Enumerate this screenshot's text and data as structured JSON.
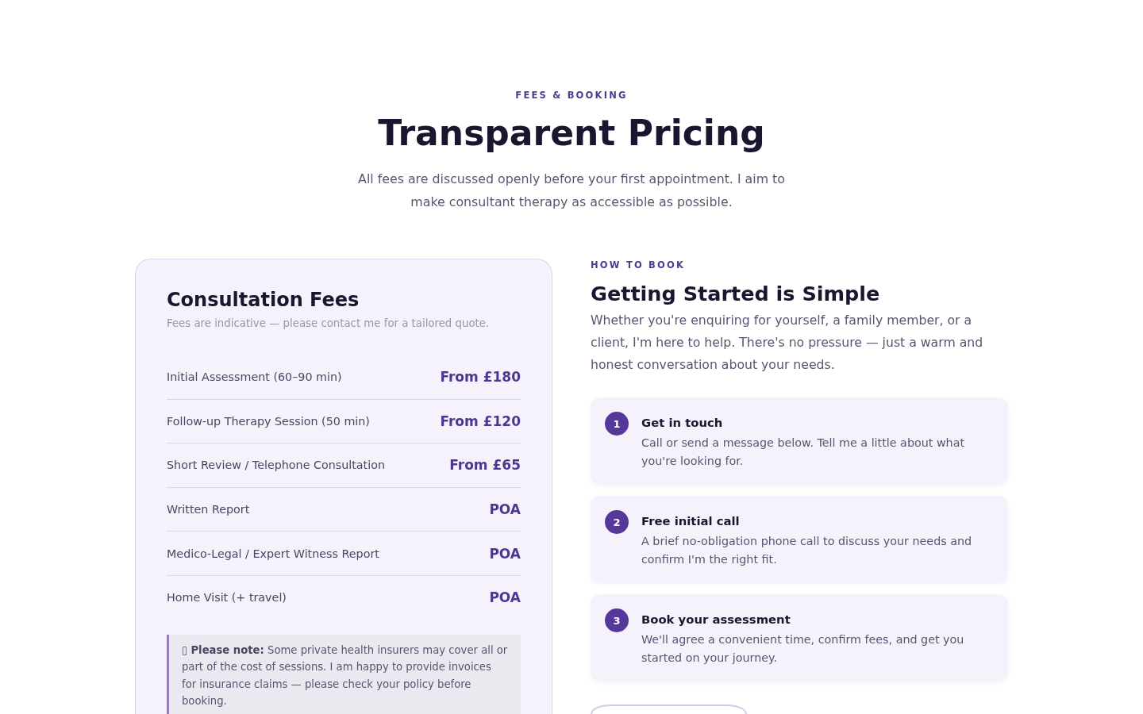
{
  "header": {
    "eyebrow": "FEES & BOOKING",
    "title": "Transparent Pricing",
    "intro": "All fees are discussed openly before your first appointment. I aim to make consultant therapy as accessible as possible."
  },
  "fees_card": {
    "title": "Consultation Fees",
    "subtitle": "Fees are indicative — please contact me for a tailored quote.",
    "rows": [
      {
        "service": "Initial Assessment (60–90 min)",
        "price": "From £180"
      },
      {
        "service": "Follow-up Therapy Session (50 min)",
        "price": "From £120"
      },
      {
        "service": "Short Review / Telephone Consultation",
        "price": "From £65"
      },
      {
        "service": "Written Report",
        "price": "POA"
      },
      {
        "service": "Medico-Legal / Expert Witness Report",
        "price": "POA"
      },
      {
        "service": "Home Visit (+ travel)",
        "price": "POA"
      }
    ],
    "note": "▯ **Please note:** Some private health insurers may cover all or part of the cost of sessions. I am happy to provide invoices for insurance claims — please check your policy before booking."
  },
  "booking": {
    "eyebrow": "HOW TO BOOK",
    "title": "Getting Started is Simple",
    "intro": "Whether you're enquiring for yourself, a family member, or a client, I'm here to help. There's no pressure — just a warm and honest conversation about your needs.",
    "steps": [
      {
        "number": "1",
        "title": "Get in touch",
        "text": "Call or send a message below. Tell me a little about what you're looking for."
      },
      {
        "number": "2",
        "title": "Free initial call",
        "text": "A brief no-obligation phone call to discuss your needs and confirm I'm the right fit."
      },
      {
        "number": "3",
        "title": "Book your assessment",
        "text": "We'll agree a convenient time, confirm fees, and get you started on your journey."
      }
    ]
  }
}
